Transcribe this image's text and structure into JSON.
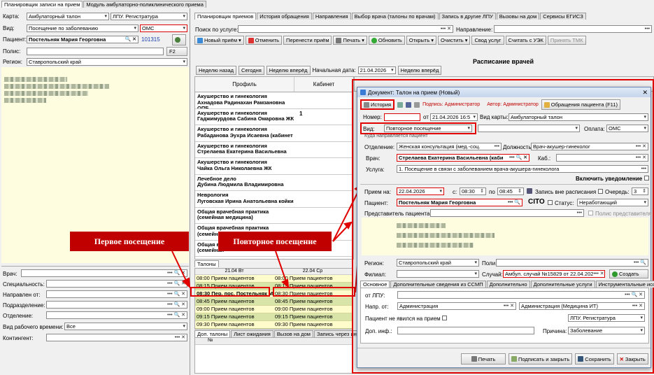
{
  "top_tabs": [
    "Планировщик записи на прием",
    "Модуль амбулаторно-поликлинического приема"
  ],
  "left": {
    "karta_label": "Карта:",
    "karta_value": "Амбулаторный талон",
    "lpu_value": "ЛПУ. Регистратура",
    "vid_label": "Вид:",
    "vid_value": "Посещение по заболеванию",
    "oms_value": "ОМС",
    "patient_label": "Пациент:",
    "patient_value": "Постельняк Мария Георговна",
    "patient_id": "101315",
    "polis_label": "Полис:",
    "f2_label": "F2",
    "region_label": "Регион:",
    "region_value": "Ставропольский край",
    "filters": [
      {
        "label": "Врач:"
      },
      {
        "label": "Специальность:"
      },
      {
        "label": "Направлен от:"
      },
      {
        "label": "Подразделение:"
      },
      {
        "label": "Отделение:"
      }
    ],
    "work_time_label": "Вид рабочего времени:",
    "work_time_value": "Все",
    "contingent_label": "Контингент:"
  },
  "right_tabs": [
    "Планировщик приемов",
    "История обращения",
    "Направления",
    "Выбор врача (талоны по врачам)",
    "Запись в другие ЛПУ",
    "Вызовы на дом",
    "Сервисы ЕГИСЗ"
  ],
  "search": {
    "service_label": "Поиск по услуге:",
    "direction_label": "Направление:"
  },
  "toolbar": [
    "Новый приём",
    "Отменить",
    "Перенести приём",
    "Печать",
    "Обновить",
    "Открыть",
    "Очистить",
    "Свод услуг",
    "Считать с УЭК",
    "Принять ТМК"
  ],
  "schedule_title": "Расписание врачей",
  "nav": {
    "prev_week": "Неделю назад",
    "today": "Сегодня",
    "next_week": "Неделю вперёд",
    "start_label": "Начальная дата:",
    "start_date": "21.04.2026",
    "next_week2": "Неделю вперёд"
  },
  "grid_headers": {
    "profile": "Профиль",
    "cabinet": "Кабинет"
  },
  "doctors": [
    {
      "bold": "Акушерство и гинекология",
      "name": "Ахнадова Радинахан Рамзановна ОПБ",
      "cab": ""
    },
    {
      "bold": "Акушерство и гинекология",
      "name": "Гаджимурдова Сабина Омаровна ЖК",
      "cab": "1"
    },
    {
      "bold": "Акушерство и гинекология",
      "name": "Рабаданова Эухра Исаевна (кабинет",
      "cab": ""
    },
    {
      "bold": "Акушерство и гинекология",
      "name": "Стрелаева Екатерина Васильевна",
      "cab": ""
    },
    {
      "bold": "Акушерство и гинекология",
      "name": "Чайка Ольга Николаевна ЖК",
      "cab": ""
    },
    {
      "bold": "Лечебное дело",
      "name": "Дубина Людмила Владимировна",
      "cab": ""
    },
    {
      "bold": "Неврология",
      "name": "Луговская Ирина Анатольевна койки",
      "cab": ""
    },
    {
      "bold": "Общая врачебная практика (семейная медицина)",
      "name": "",
      "cab": ""
    },
    {
      "bold": "Общая врачебная практика (семейная",
      "name": "",
      "cab": ""
    },
    {
      "bold": "Общая врачебная практика (семейная",
      "name": "",
      "cab": ""
    }
  ],
  "callouts": {
    "first": "Первое посещение",
    "repeat": "Повторное посещение"
  },
  "talons_tab": "Талоны",
  "days": [
    "21.04 Вт",
    "22.04 Ср"
  ],
  "slots_left": [
    "08:00 Прием пациентов",
    "08:15 Прием пациентов",
    "08:30 Пер. пос. Постельняк М",
    "08:45 Прием пациентов",
    "09:00 Прием пациентов",
    "09:15 Прием пациентов",
    "09:30 Прием пациентов"
  ],
  "slots_right": [
    "08:00 Прием пациентов",
    "08:15 Прием пациентов",
    "08:30 Прием пациентов",
    "08:45 Прием пациентов",
    "09:00 Прием пациентов",
    "09:15 Прием пациентов",
    "09:30 Прием пациентов"
  ],
  "bottom_tabs": [
    "Доп. талоны",
    "Лист ожидания",
    "Вызов на дом",
    "Запись через интернет"
  ],
  "bottom_col": "№",
  "dialog": {
    "title": "Документ: Талон на прием (Новый)",
    "history_btn": "История",
    "signatures": "Подпись: Администратор",
    "author": "Автор: Администратор",
    "appeals": "Обращения пациента (F11)",
    "nomer_label": "Номер:",
    "ot_label": "от",
    "date_value": "21.04.2026 16:5",
    "vid_karty_label": "Вид карты:",
    "vid_karty_value": "Амбулаторный талон",
    "vid_label": "Вид:",
    "vid_value": "Повторное посещение",
    "oplata_label": "Оплата:",
    "oplata_value": "ОМС",
    "kuda_label": "Куда направляется пациент",
    "otdelenie_label": "Отделение:",
    "otdelenie_value": "Женская консультация (мед.-соц.",
    "dolzhnost_label": "Должность:",
    "dolzhnost_value": "Врач-акушер-гинеколог",
    "vrach_label": "Врач:",
    "vrach_value": "Стрелаева Екатерина Васильевна (каби",
    "kab_label": "Каб.:",
    "usluga_label": "Услуга:",
    "usluga_value": "1. Посещение в связи с заболеванием врача-акушера-гинеколога",
    "notify": "Включить уведомление",
    "priem_label": "Прием на:",
    "priem_date": "22.04.2026",
    "s_label": "с:",
    "s_time": "08:30",
    "po_label": "по",
    "po_time": "08:45",
    "vne_label": "Запись вне расписания",
    "ochered_label": "Очередь:",
    "ochered_value": "3",
    "patient_label": "Пациент:",
    "patient_value": "Постельняк Мария Георговна",
    "cito": "CITO",
    "status_label": "Статус:",
    "status_value": "Неработающий",
    "predst_label": "Представитель пациента:",
    "polis_predst": "Полис представителя",
    "region_label": "Регион:",
    "region_value": "Ставропольский край",
    "poli_label": "Поли",
    "filial_label": "Филиал:",
    "sluchai_label": "Случай:",
    "sluchai_value": "Амбул. случай №15829 от 22.04.202",
    "create_btn": "Создать",
    "subtabs": [
      "Основное",
      "Дополнительные сведения из ССМП",
      "Дополнительно",
      "Дополнительные услуги",
      "Инструментальные исследования"
    ],
    "ot_lpu_label": "от ЛПУ:",
    "napr_ot_label": "Напр. от:",
    "napr_ot_value": "Администрация",
    "napr_ot2_value": "Администрация (Медицина ИТ)",
    "ne_yavilsya": "Пациент не явился на прием",
    "lpu_value": "ЛПУ. Регистратура",
    "dop_inf_label": "Доп. инф.:",
    "prichina_label": "Причина:",
    "prichina_value": "Заболевание",
    "btn_print": "Печать",
    "btn_sign_close": "Подписать и закрыть",
    "btn_save": "Сохранить",
    "btn_close": "Закрыть"
  }
}
